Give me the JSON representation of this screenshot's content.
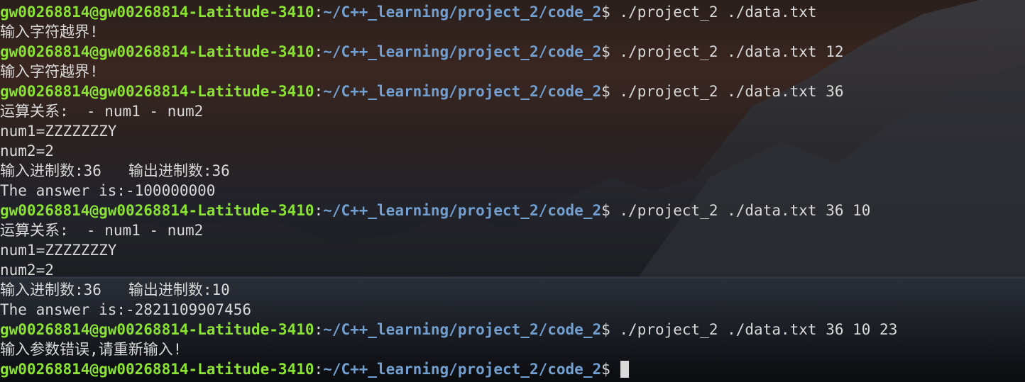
{
  "prompt": {
    "user_host": "gw00268814@gw00268814-Latitude-3410",
    "separator": ":",
    "path": "~/C++_learning/project_2/code_2",
    "symbol": "$ "
  },
  "lines": [
    {
      "type": "cmd",
      "text": "./project_2 ./data.txt"
    },
    {
      "type": "out",
      "text": "输入字符越界!"
    },
    {
      "type": "cmd",
      "text": "./project_2 ./data.txt 12"
    },
    {
      "type": "out",
      "text": "输入字符越界!"
    },
    {
      "type": "cmd",
      "text": "./project_2 ./data.txt 36"
    },
    {
      "type": "out",
      "text": "运算关系:  - num1 - num2"
    },
    {
      "type": "out",
      "text": "num1=ZZZZZZZY"
    },
    {
      "type": "out",
      "text": "num2=2"
    },
    {
      "type": "out",
      "text": "输入进制数:36   输出进制数:36"
    },
    {
      "type": "out",
      "text": "The answer is:-100000000"
    },
    {
      "type": "cmd",
      "text": "./project_2 ./data.txt 36 10"
    },
    {
      "type": "out",
      "text": "运算关系:  - num1 - num2"
    },
    {
      "type": "out",
      "text": "num1=ZZZZZZZY"
    },
    {
      "type": "out",
      "text": "num2=2"
    },
    {
      "type": "out",
      "text": "输入进制数:36   输出进制数:10"
    },
    {
      "type": "out",
      "text": "The answer is:-2821109907456"
    },
    {
      "type": "cmd",
      "text": "./project_2 ./data.txt 36 10 23"
    },
    {
      "type": "out",
      "text": "输入参数错误,请重新输入!"
    },
    {
      "type": "cmd",
      "text": ""
    }
  ],
  "colors": {
    "prompt_user": "#8ae234",
    "prompt_path": "#729fcf",
    "text": "#d9d9d9"
  }
}
